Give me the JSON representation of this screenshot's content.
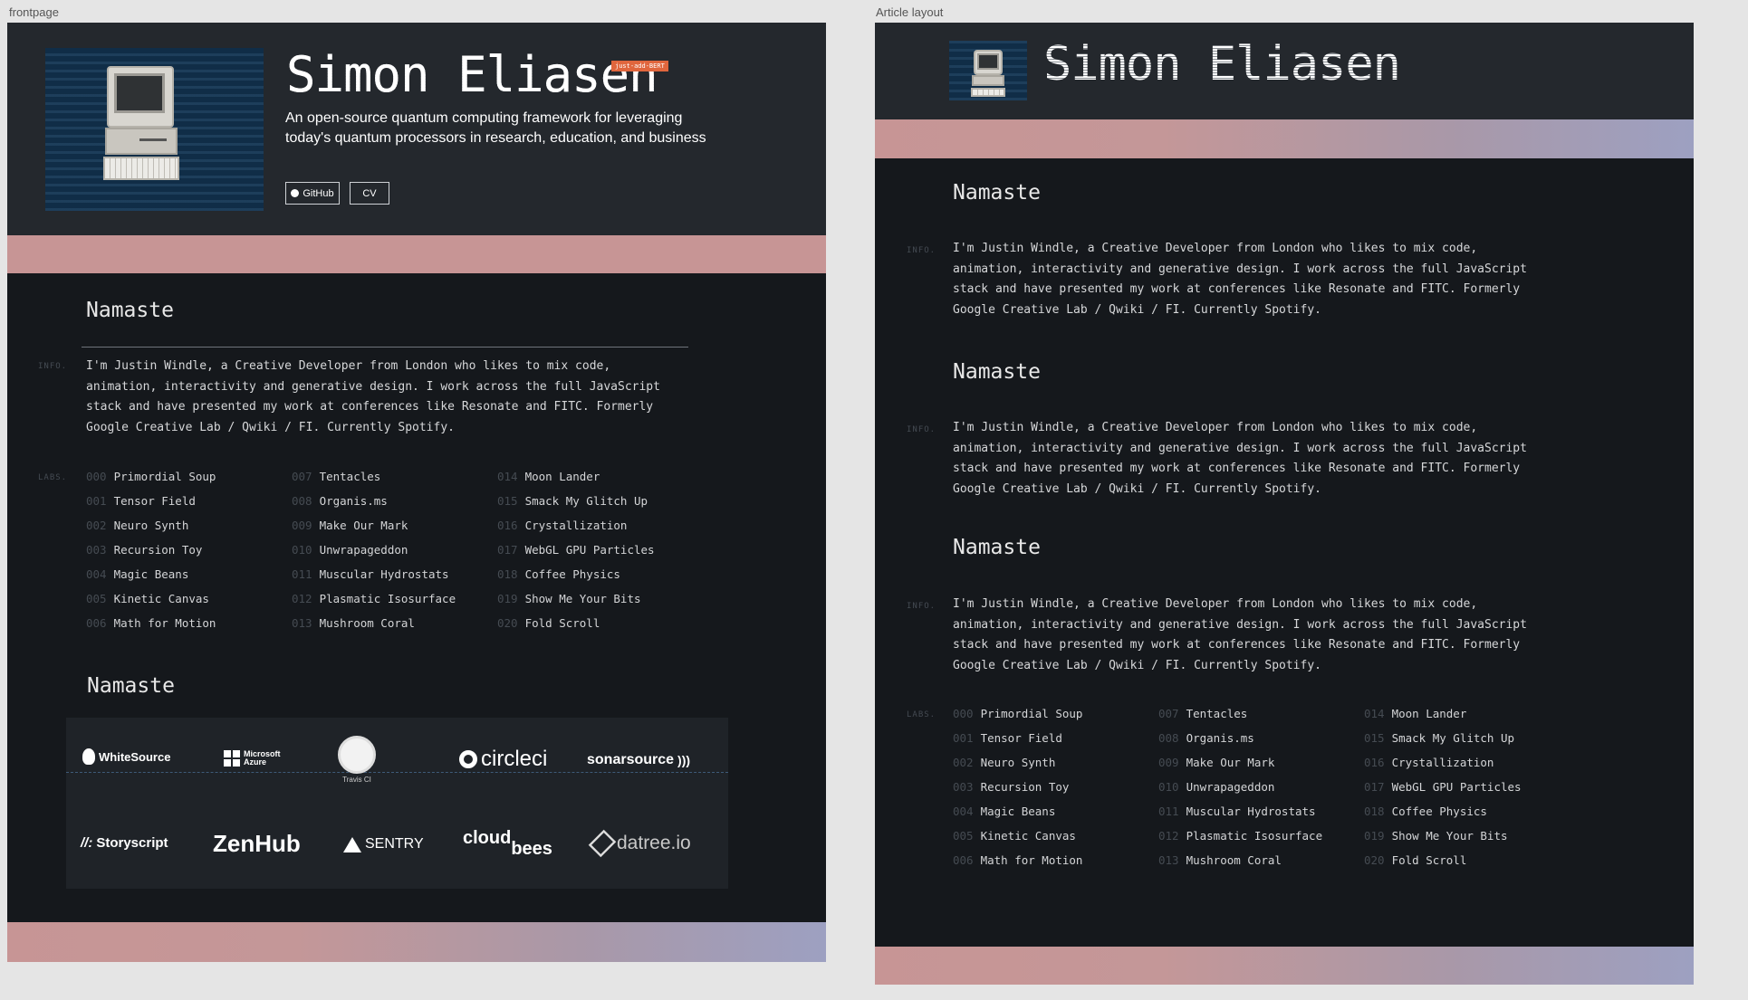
{
  "frames": {
    "front_label": "frontpage",
    "article_label": "Article layout"
  },
  "hero": {
    "title": "Simon Eliasen",
    "badge": "just-add-BERT",
    "description": "An open-source quantum computing framework for leveraging today's quantum processors in research, education, and business",
    "github_label": "GitHub",
    "cv_label": "CV"
  },
  "section": {
    "heading": "Namaste",
    "info_label": "INFO.",
    "labs_label": "LABS.",
    "paragraph": "I'm Justin Windle, a Creative Developer from London who likes to mix code, animation, interactivity and generative design. I work across the full JavaScript stack and have presented my work at conferences like Resonate and FITC. Formerly Google Creative Lab / Qwiki / FI. Currently Spotify."
  },
  "labs": [
    [
      {
        "num": "000",
        "name": "Primordial Soup"
      },
      {
        "num": "001",
        "name": "Tensor Field"
      },
      {
        "num": "002",
        "name": "Neuro Synth"
      },
      {
        "num": "003",
        "name": "Recursion Toy"
      },
      {
        "num": "004",
        "name": "Magic Beans"
      },
      {
        "num": "005",
        "name": "Kinetic Canvas"
      },
      {
        "num": "006",
        "name": "Math for Motion"
      }
    ],
    [
      {
        "num": "007",
        "name": "Tentacles"
      },
      {
        "num": "008",
        "name": "Organis.ms"
      },
      {
        "num": "009",
        "name": "Make Our Mark"
      },
      {
        "num": "010",
        "name": "Unwrapageddon"
      },
      {
        "num": "011",
        "name": "Muscular Hydrostats"
      },
      {
        "num": "012",
        "name": "Plasmatic Isosurface"
      },
      {
        "num": "013",
        "name": "Mushroom Coral"
      }
    ],
    [
      {
        "num": "014",
        "name": "Moon Lander"
      },
      {
        "num": "015",
        "name": "Smack My Glitch Up"
      },
      {
        "num": "016",
        "name": "Crystallization"
      },
      {
        "num": "017",
        "name": "WebGL GPU Particles"
      },
      {
        "num": "018",
        "name": "Coffee Physics"
      },
      {
        "num": "019",
        "name": "Show Me Your Bits"
      },
      {
        "num": "020",
        "name": "Fold Scroll"
      }
    ]
  ],
  "logos": {
    "whitesource": "WhiteSource",
    "azure_1": "Microsoft",
    "azure_2": "Azure",
    "travis": "Travis CI",
    "circleci": "circleci",
    "sonar": "sonarsource",
    "storyscript": "Storyscript",
    "zenhub": "ZenHub",
    "sentry": "SENTRY",
    "cloudbees_1": "cloud",
    "cloudbees_2": "bees",
    "datree": "datree.io"
  },
  "colors": {
    "page_bg": "#15181c",
    "header_bg": "#24282d",
    "band_pink": "#c79595",
    "band_blue": "#9da0c1",
    "badge": "#e0663d"
  }
}
